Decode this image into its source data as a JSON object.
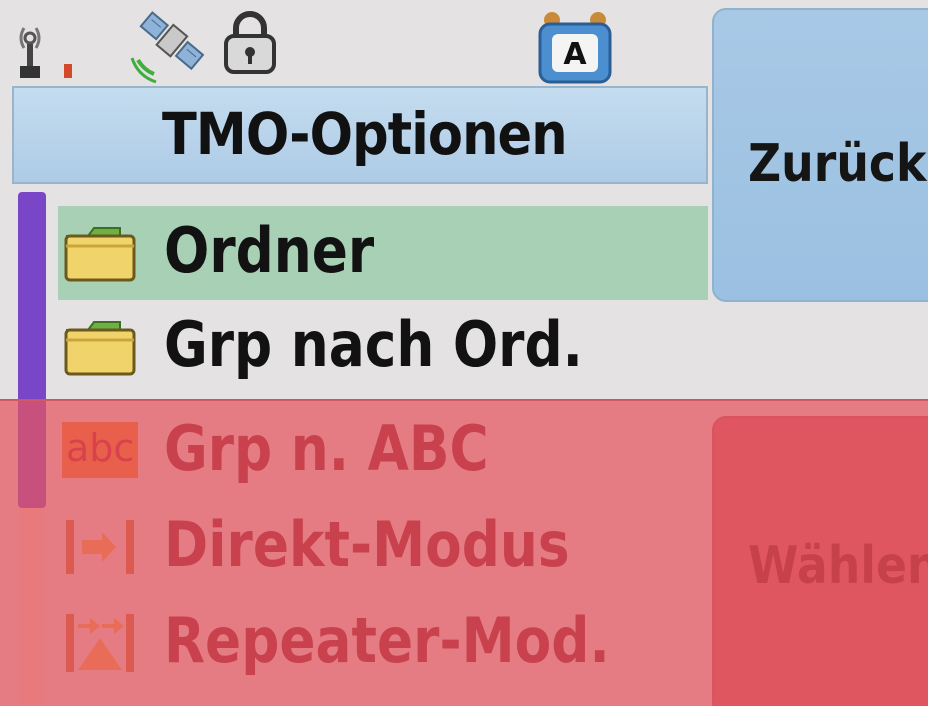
{
  "status_bar": {
    "icons": [
      "signal-antenna-icon",
      "satellite-icon",
      "lock-icon",
      "text-mode-a-icon"
    ],
    "text_mode_letter": "A"
  },
  "header": {
    "title": "TMO-Optionen"
  },
  "softkeys": {
    "back_label": "Zurück",
    "select_label": "Wählen"
  },
  "menu": {
    "items": [
      {
        "label": "Ordner",
        "icon": "folder-icon",
        "selected": true
      },
      {
        "label": "Grp nach Ord.",
        "icon": "folder-icon",
        "selected": false
      },
      {
        "label": "Grp n. ABC",
        "icon": "abc-sort-icon",
        "icon_text": "abc",
        "selected": false
      },
      {
        "label": "Direkt-Modus",
        "icon": "direct-mode-icon",
        "selected": false
      },
      {
        "label": "Repeater-Mod.",
        "icon": "repeater-mode-icon",
        "selected": false
      }
    ]
  },
  "colors": {
    "title_bar": "#b6d1e8",
    "selected_row": "#a8d0b4",
    "scroll_thumb": "#7a46c8",
    "danger_overlay": "#e4555f",
    "label_text": "#121212"
  }
}
